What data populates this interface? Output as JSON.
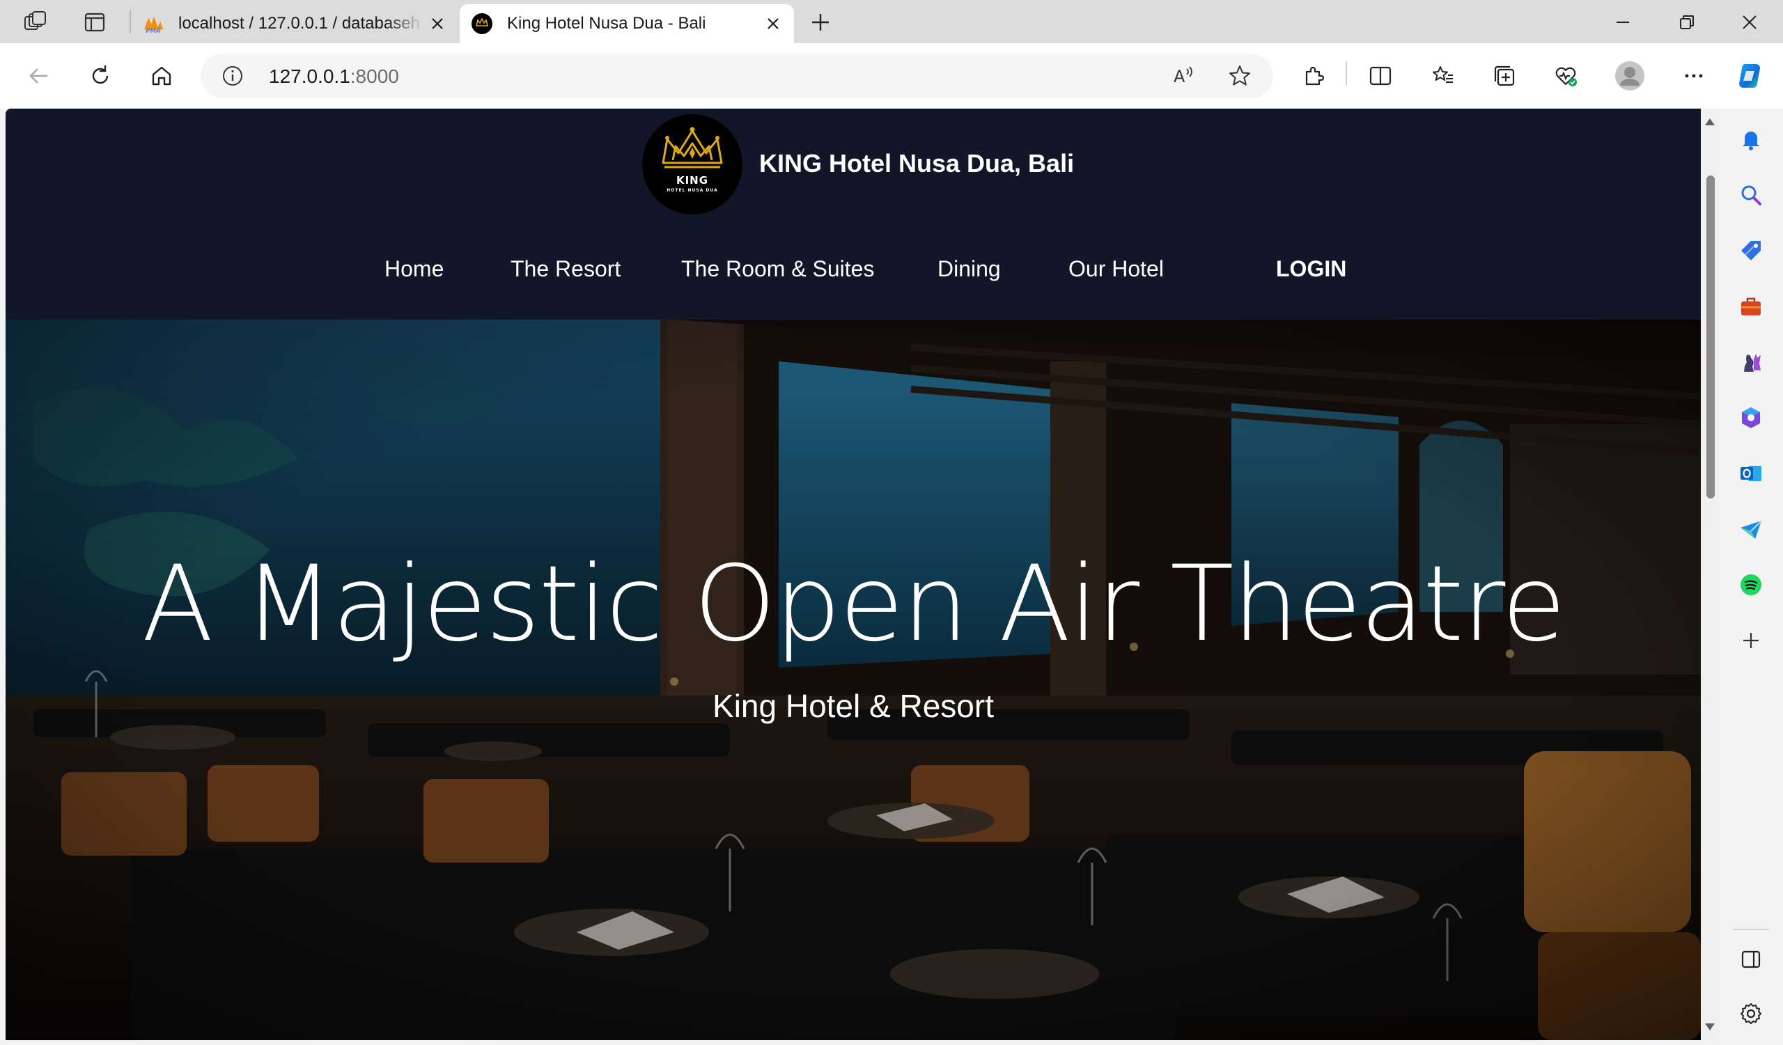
{
  "browser": {
    "tabs": [
      {
        "title": "localhost / 127.0.0.1 / databaseh",
        "favicon": "phpmyadmin-icon",
        "favicon_text": "PMA"
      },
      {
        "title": "King Hotel Nusa Dua - Bali",
        "favicon": "king-crown-icon"
      }
    ],
    "address": {
      "host": "127.0.0.1",
      "port": ":8000"
    },
    "accent": "#0078d4"
  },
  "site": {
    "logo": {
      "word": "KING",
      "sub": "HOTEL NUSA DUA"
    },
    "name": "KING Hotel Nusa Dua, Bali",
    "nav": [
      "Home",
      "The Resort",
      "The Room & Suites",
      "Dining",
      "Our Hotel"
    ],
    "login": "LOGIN",
    "colors": {
      "header_bg": "#111629",
      "logo_gold": "#e0a818"
    }
  },
  "hero": {
    "title": "A Majestic Open Air Theatre",
    "subtitle": "King Hotel & Resort"
  }
}
